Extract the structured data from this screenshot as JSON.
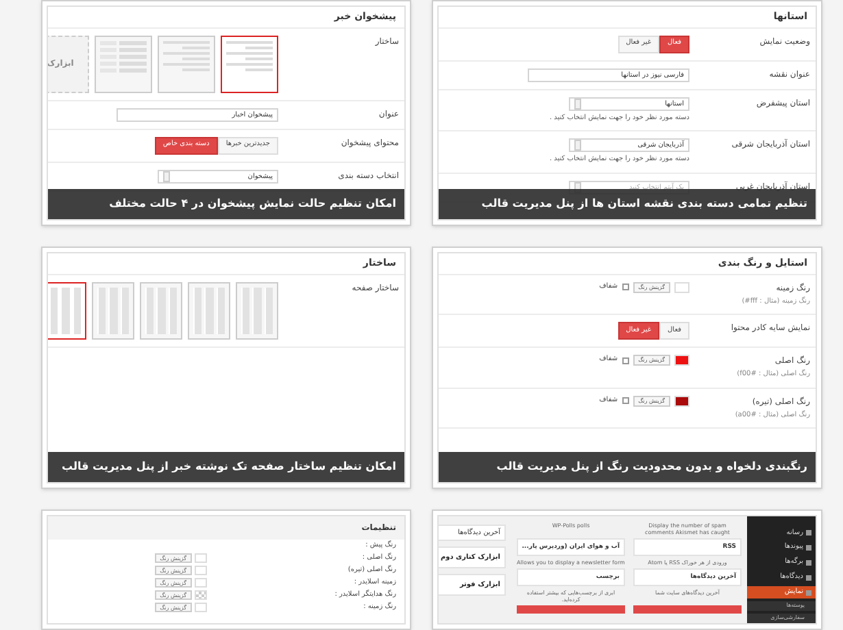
{
  "cards": [
    {
      "kind": "form",
      "heading": "استانها",
      "caption": "تنظیم تمامی دسته بندی نقشه استان ها از پنل مدیریت قالب",
      "rows": [
        {
          "kind": "toggle",
          "label": "وضعیت نمایش",
          "options": [
            {
              "label": "فعال",
              "selected": true
            },
            {
              "label": "غیر فعال",
              "selected": false
            }
          ]
        },
        {
          "kind": "input",
          "label": "عنوان نقشه",
          "value": "فارسی نیوز در استانها"
        },
        {
          "kind": "select",
          "label": "استان پیشفرض",
          "value": "استانها",
          "note": "دسته مورد نظر خود را جهت نمایش انتخاب کنید ."
        },
        {
          "kind": "select",
          "label": "استان آذربایجان شرقی",
          "value": "آذربایجان شرقی",
          "note": "دسته مورد نظر خود را جهت نمایش انتخاب کنید ."
        },
        {
          "kind": "select",
          "label": "استان آذربایجان غربی",
          "placeholder": "یک آیتم انتخاب کنید"
        }
      ]
    },
    {
      "kind": "form",
      "heading": "پیشخوان خبر",
      "caption": "امکان تنظیم حالت نمایش پیشخوان در ۴ حالت مختلف",
      "rows": [
        {
          "kind": "layouts",
          "label": "ساختار",
          "thumbs": [
            {
              "kind": "rows",
              "selected": true
            },
            {
              "kind": "rows",
              "selected": false
            },
            {
              "kind": "split",
              "selected": false
            },
            {
              "kind": "widget",
              "label": "ابزارک",
              "selected": false
            }
          ]
        },
        {
          "kind": "input",
          "label": "عنوان",
          "value": "پیشخوان اخبار"
        },
        {
          "kind": "toggle",
          "label": "محتوای پیشخوان",
          "options": [
            {
              "label": "جدیدترین خبرها",
              "selected": false
            },
            {
              "label": "دسته بندی خاص",
              "selected": true
            }
          ]
        },
        {
          "kind": "select",
          "label": "انتخاب دسته بندی",
          "value": "پیشخوان"
        }
      ]
    },
    {
      "kind": "form",
      "heading": "استایل و رنگ بندی",
      "caption": "رنگبندی دلخواه و بدون محدودیت رنگ از پنل مدیریت قالب",
      "rows": [
        {
          "kind": "color",
          "label": "رنگ زمینه",
          "note": "رنگ زمینه (مثال : fff#)",
          "color": "#ffffff",
          "button": "گزینش رنگ",
          "check": "شفاف",
          "checked": false
        },
        {
          "kind": "toggle",
          "label": "نمایش سایه کادر محتوا",
          "options": [
            {
              "label": "فعال",
              "selected": false
            },
            {
              "label": "غیر فعال",
              "selected": true
            }
          ]
        },
        {
          "kind": "color",
          "label": "رنگ اصلی",
          "note": "رنگ اصلی (مثال : f00#)",
          "color": "#ee1111",
          "button": "گزینش رنگ",
          "check": "شفاف",
          "checked": false
        },
        {
          "kind": "color",
          "label": "رنگ اصلی (تیره)",
          "note": "رنگ اصلی (مثال : a00#)",
          "color": "#aa0a0a",
          "button": "گزینش رنگ",
          "check": "شفاف",
          "checked": false
        }
      ]
    },
    {
      "kind": "form",
      "heading": "ساختار",
      "caption": "امکان تنظیم ساختار صفحه تک نوشته خبر از پنل مدیریت قالب",
      "rows": [
        {
          "kind": "layouts",
          "label": "ساختار صفحه",
          "thumbs": [
            {
              "kind": "cols",
              "selected": false
            },
            {
              "kind": "cols",
              "selected": false
            },
            {
              "kind": "cols",
              "selected": false
            },
            {
              "kind": "cols",
              "selected": false
            },
            {
              "kind": "cols",
              "selected": true
            }
          ]
        }
      ]
    },
    {
      "kind": "widgets",
      "menu": [
        {
          "label": "رسانه",
          "selected": false
        },
        {
          "label": "پیوندها",
          "selected": false
        },
        {
          "label": "برگه‌ها",
          "selected": false
        },
        {
          "label": "دیدگاه‌ها",
          "selected": false
        },
        {
          "label": "نمایش",
          "selected": true
        }
      ],
      "submenu": [
        {
          "label": "پوسته‌ها"
        },
        {
          "label": "سفارشی‌سازی"
        }
      ],
      "available": [
        {
          "desc": "Display the number of spam comments Akismet has caught"
        },
        {
          "desc": "WP-Polls polls"
        },
        {
          "title": "RSS",
          "desc": "ورودی از هر خوراک RSS یا Atom"
        },
        {
          "title": "آب و هوای ایران (وردپرس پار...",
          "desc": "Allows you to display a newsletter form"
        },
        {
          "title": "آخرین دیدگاه‌ها",
          "desc": "آخرین دیدگاه‌های سایت شما"
        },
        {
          "title": "برچسب",
          "desc": "ابری از برچسب‌هایی که بیشتر استفاده کرده‌اید."
        }
      ],
      "areas": [
        {
          "title": "آخرین دیدگاه‌ها",
          "kind": "widget"
        },
        {
          "title": "ابزارک کناری دوم",
          "kind": "area"
        },
        {
          "title": "ابزارک فوتر",
          "kind": "area"
        }
      ]
    },
    {
      "kind": "list",
      "heading": "تنظیمات",
      "rows": [
        {
          "label": "رنگ پیش :"
        },
        {
          "label": "رنگ اصلی :",
          "button": "گزینش رنگ",
          "pattern": false
        },
        {
          "label": "رنگ اصلی (تیره)",
          "button": "گزینش رنگ",
          "pattern": false
        },
        {
          "label": "زمینه اسلایدر :",
          "button": "گزینش رنگ",
          "pattern": false
        },
        {
          "label": "رنگ هدایتگر اسلایدر :",
          "button": "گزینش رنگ",
          "pattern": true
        },
        {
          "label": "رنگ زمینه :",
          "button": "گزینش رنگ",
          "pattern": false
        }
      ]
    }
  ]
}
